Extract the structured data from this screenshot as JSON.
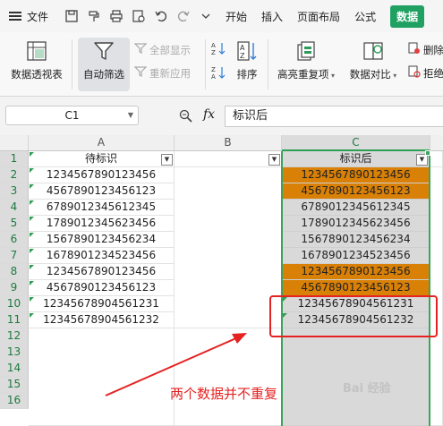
{
  "menubar": {
    "file_label": "文件",
    "items": [
      "开始",
      "插入",
      "页面布局",
      "公式",
      "数据"
    ],
    "active_item": "数据"
  },
  "ribbon": {
    "pivot_label": "数据透视表",
    "autofilter_label": "自动筛选",
    "show_all_label": "全部显示",
    "reapply_label": "重新应用",
    "sort_label": "排序",
    "highlight_dup_label": "高亮重复项",
    "compare_label": "数据对比",
    "delete_label": "删除",
    "reject_label": "拒绝"
  },
  "formula_bar": {
    "cell_ref": "C1",
    "fx_label": "fx",
    "content": "标识后"
  },
  "grid": {
    "columns": [
      "A",
      "B",
      "C"
    ],
    "rows": [
      "1",
      "2",
      "3",
      "4",
      "5",
      "6",
      "7",
      "8",
      "9",
      "10",
      "11",
      "12",
      "13",
      "14",
      "15",
      "16"
    ],
    "headers": {
      "a": "待标识",
      "c": "标识后"
    },
    "col_a": [
      "1234567890123456",
      "4567890123456123",
      "6789012345612345",
      "1789012345623456",
      "1567890123456234",
      "1678901234523456",
      "1234567890123456",
      "4567890123456123",
      "12345678904561231",
      "12345678904561232"
    ],
    "col_c": [
      "1234567890123456",
      "4567890123456123",
      "6789012345612345",
      "1789012345623456",
      "1567890123456234",
      "1678901234523456",
      "1234567890123456",
      "4567890123456123",
      "12345678904561231",
      "12345678904561232"
    ],
    "col_c_highlighted": [
      true,
      true,
      false,
      false,
      false,
      false,
      true,
      true,
      false,
      false
    ]
  },
  "annotation": {
    "text": "两个数据并不重复",
    "watermark": "Bai 经验"
  },
  "colors": {
    "accent_green": "#20a162",
    "duplicate_highlight": "#d98007",
    "annotation_red": "#e52222"
  }
}
